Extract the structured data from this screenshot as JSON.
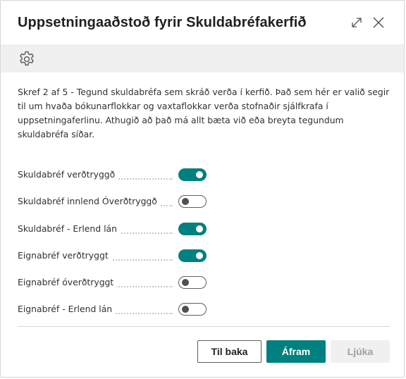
{
  "dialog": {
    "title": "Uppsetningaaðstoð fyrir Skuldabréfakerfið",
    "expand_icon": "expand-icon",
    "close_icon": "close-icon"
  },
  "actionbar": {
    "settings_icon": "gear-icon"
  },
  "description": "Skref 2 af 5 - Tegund skuldabréfa sem skráð verða í kerfið. Það sem hér er valið segir til um hvaða bókunarflokkar og vaxtaflokkar verða stofnaðir sjálfkrafa í uppsetningaferlinu. Athugið að það má allt bæta við eða breyta tegundum skuldabréfa síðar.",
  "fields": [
    {
      "label": "Skuldabréf verðtryggð",
      "value": true
    },
    {
      "label": "Skuldabréf innlend Óverðtryggð",
      "value": false
    },
    {
      "label": "Skuldabréf - Erlend lán",
      "value": true
    },
    {
      "label": "Eignabréf verðtryggt",
      "value": true
    },
    {
      "label": "Eignabréf óverðtryggt",
      "value": false
    },
    {
      "label": "Eignabréf - Erlend lán",
      "value": false
    }
  ],
  "buttons": {
    "back": "Til baka",
    "next": "Áfram",
    "finish": "Ljúka"
  },
  "colors": {
    "accent": "#00807f",
    "disabled_bg": "#f0f0f0"
  }
}
